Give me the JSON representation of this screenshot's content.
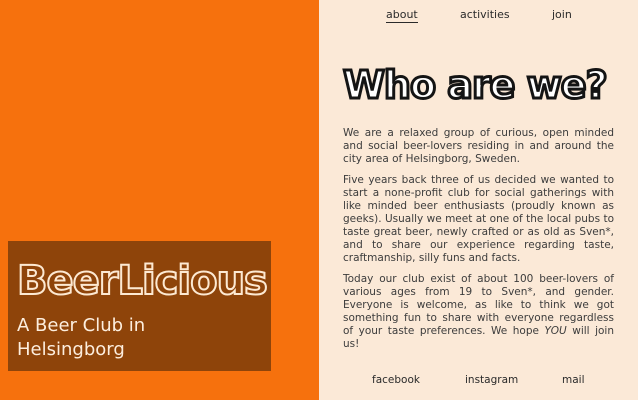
{
  "nav": {
    "about": "about",
    "activities": "activities",
    "join": "join"
  },
  "hero": {
    "title": "BeerLicious",
    "tagline": "A Beer Club in Helsingborg"
  },
  "main": {
    "heading": "Who are we?",
    "paragraph1": "We are a relaxed group of curious, open minded and social beer-lovers residing in and around the city area of Helsingborg, Sweden.",
    "paragraph2": "Five years back three of us decided we wanted to start a none-profit club for social gatherings with like minded beer enthusiasts (proudly known as geeks). Usually we meet at one of the local pubs to taste great beer, newly crafted or as old as Sven*, and to share our experience regarding taste, craftmanship, silly funs and facts.",
    "paragraph3_start": "Today our club exist of about 100 beer-lovers of various ages from 19 to Sven*, and gender. Everyone is welcome, as like to think we got something fun to share with everyone regardless of your taste preferences. We hope",
    "paragraph3_emph": "YOU",
    "paragraph3_end": "will join us!"
  },
  "footer": {
    "facebook": "facebook",
    "instagram": "instagram",
    "mail": "mail"
  },
  "colors": {
    "orange": "#f6710d",
    "brown": "#8e440a",
    "cream": "#fbe9d7"
  }
}
